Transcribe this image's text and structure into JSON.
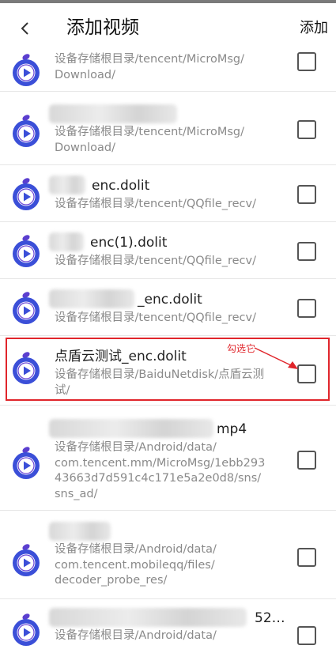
{
  "header": {
    "title": "添加视频",
    "add_label": "添加"
  },
  "annotation": "勾选它",
  "colors": {
    "icon_blue": "#3b4fd8",
    "icon_purple": "#7a3fd0",
    "highlight_red": "#e0252b"
  },
  "files": [
    {
      "name": "",
      "path": "设备存储根目录/tencent/MicroMsg/\nDownload/",
      "checked": false
    },
    {
      "name": "",
      "path": "设备存储根目录/tencent/MicroMsg/\nDownload/",
      "checked": false
    },
    {
      "name": "enc.dolit",
      "path": "设备存储根目录/tencent/QQfile_recv/",
      "checked": false
    },
    {
      "name": "enc(1).dolit",
      "path": "设备存储根目录/tencent/QQfile_recv/",
      "checked": false
    },
    {
      "name": "_enc.dolit",
      "path": "设备存储根目录/tencent/QQfile_recv/",
      "checked": false
    },
    {
      "name": "点盾云测试_enc.dolit",
      "path": "设备存储根目录/BaiduNetdisk/点盾云测\n试/",
      "checked": false
    },
    {
      "name": "mp4",
      "path": "设备存储根目录/Android/data/\ncom.tencent.mm/MicroMsg/1ebb293\n43663d7d591c4c171e5a2e0d8/sns/\nsns_ad/",
      "checked": false
    },
    {
      "name": "",
      "path": "设备存储根目录/Android/data/\ncom.tencent.mobileqq/files/\ndecoder_probe_res/",
      "checked": false
    },
    {
      "name": "52…",
      "path": "设备存储根目录/Android/data/",
      "checked": false
    }
  ]
}
